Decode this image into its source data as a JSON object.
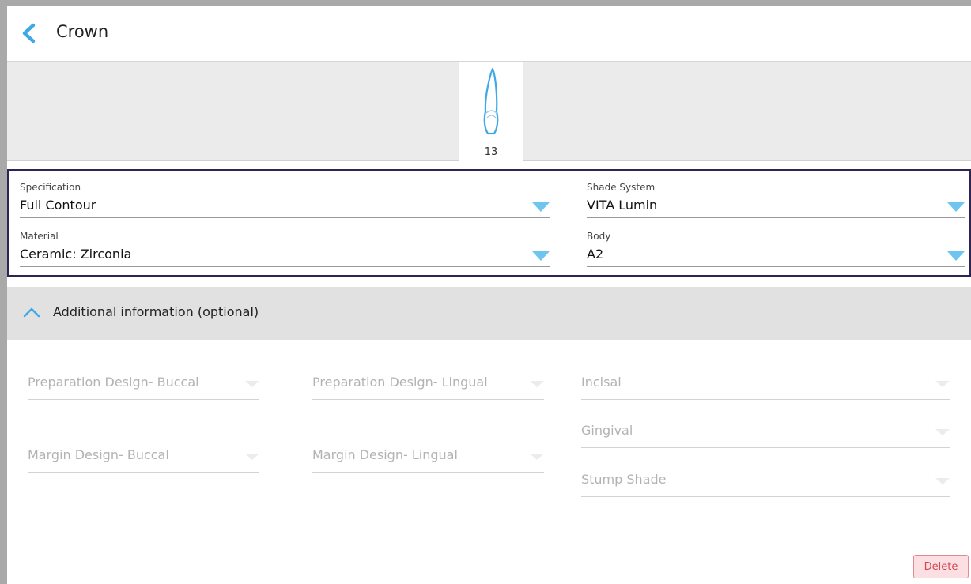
{
  "header": {
    "title": "Crown"
  },
  "tooth": {
    "number": "13"
  },
  "spec": {
    "specification": {
      "label": "Specification",
      "value": "Full Contour"
    },
    "shade_system": {
      "label": "Shade System",
      "value": "VITA Lumin"
    },
    "material": {
      "label": "Material",
      "value": "Ceramic: Zirconia"
    },
    "body": {
      "label": "Body",
      "value": "A2"
    }
  },
  "additional": {
    "label": "Additional information (optional)",
    "fields": {
      "prep_buccal": "Preparation Design- Buccal",
      "prep_lingual": "Preparation Design- Lingual",
      "incisal": "Incisal",
      "gingival": "Gingival",
      "margin_buccal": "Margin Design- Buccal",
      "margin_lingual": "Margin Design- Lingual",
      "stump_shade": "Stump Shade"
    }
  },
  "actions": {
    "delete": "Delete"
  },
  "colors": {
    "accent": "#3fa9e6",
    "frame": "#2d2354",
    "delete_bg": "#fcdfe2",
    "delete_text": "#d4474f"
  },
  "icons": {
    "back": "chevron-left-icon",
    "expand": "chevron-up-icon",
    "dropdown": "caret-down-icon"
  }
}
